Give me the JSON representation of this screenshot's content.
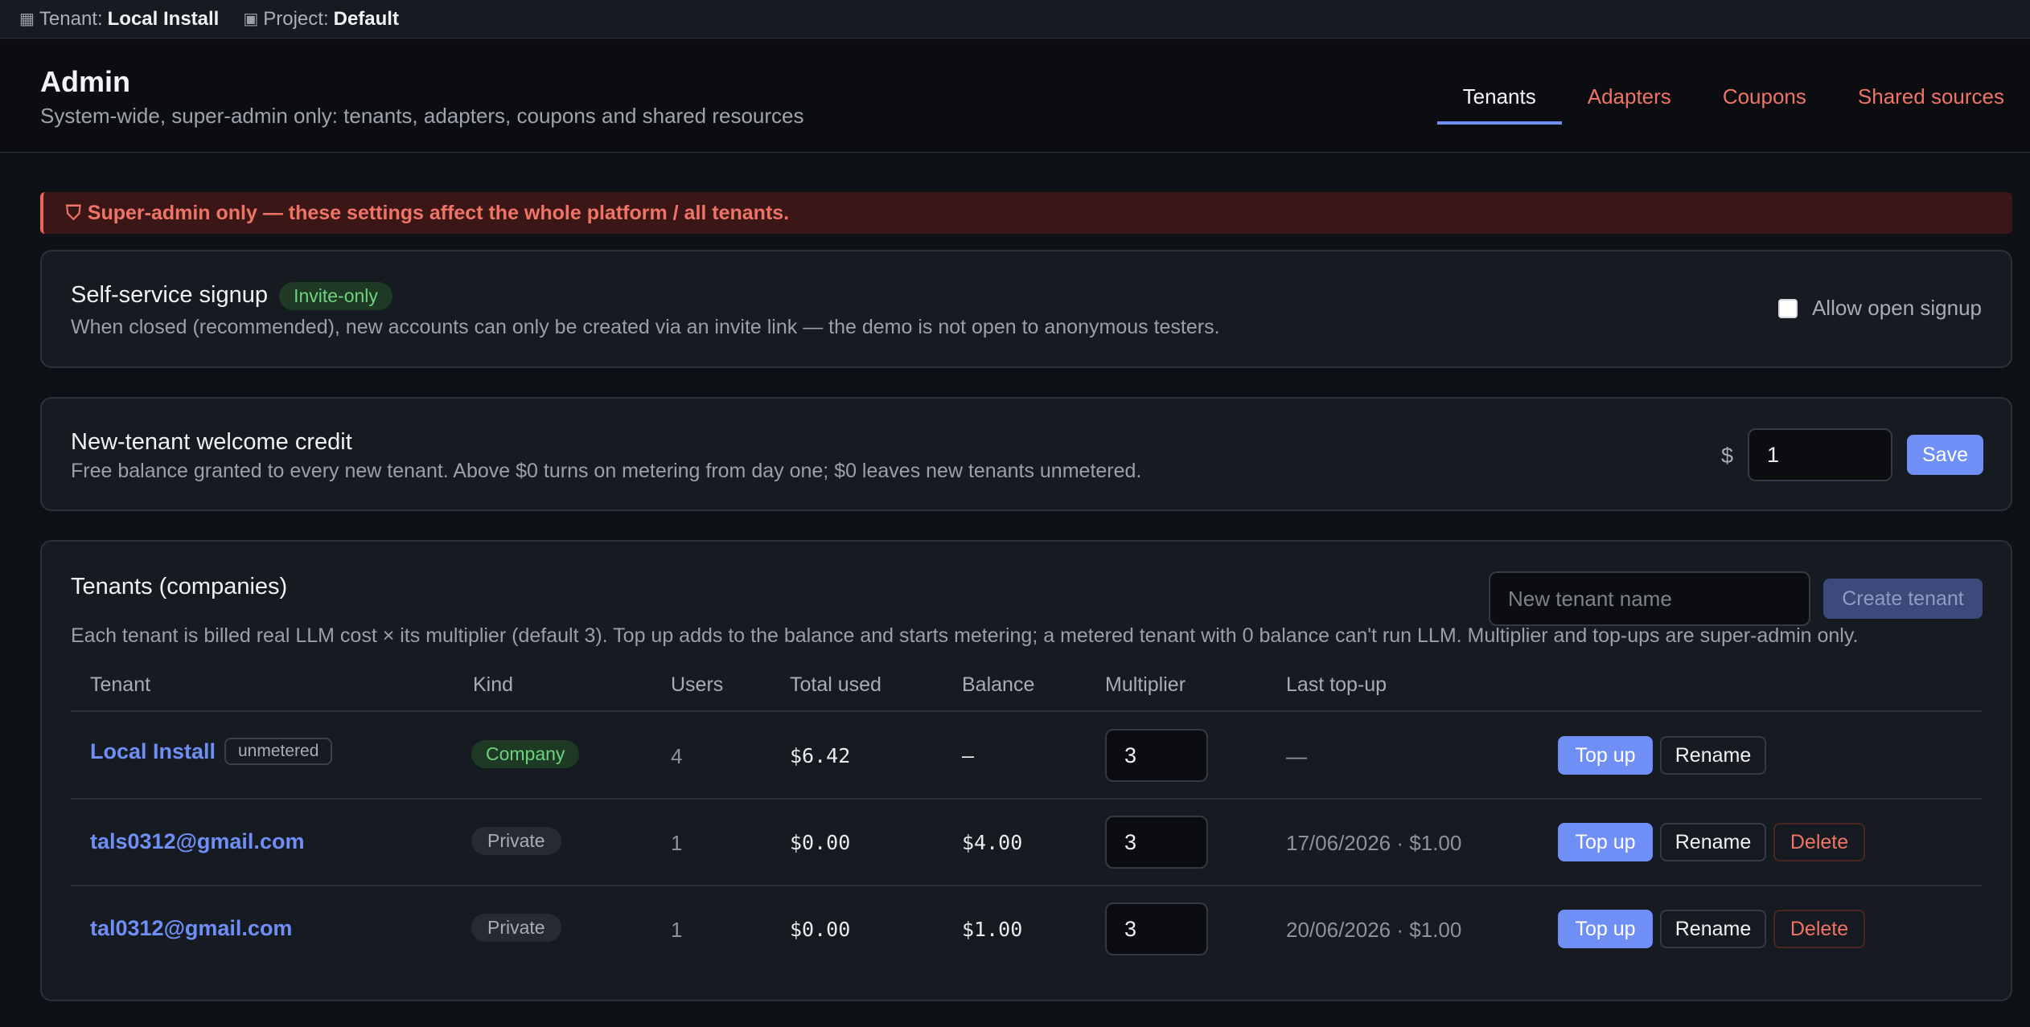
{
  "topbar": {
    "tenant_label": "Tenant:",
    "tenant_value": "Local Install",
    "project_label": "Project:",
    "project_value": "Default"
  },
  "header": {
    "title": "Admin",
    "subtitle": "System-wide, super-admin only: tenants, adapters, coupons and shared resources",
    "tabs": [
      {
        "label": "Tenants",
        "active": true
      },
      {
        "label": "Adapters",
        "active": false
      },
      {
        "label": "Coupons",
        "active": false
      },
      {
        "label": "Shared sources",
        "active": false
      }
    ]
  },
  "warning": {
    "icon": "shield-icon",
    "text": "Super-admin only — these settings affect the whole platform / all tenants."
  },
  "signup": {
    "title": "Self-service signup",
    "badge": "Invite-only",
    "desc": "When closed (recommended), new accounts can only be created via an invite link — the demo is not open to anonymous testers.",
    "checkbox_label": "Allow open signup",
    "checked": false
  },
  "credit": {
    "title": "New-tenant welcome credit",
    "desc": "Free balance granted to every new tenant. Above $0 turns on metering from day one; $0 leaves new tenants unmetered.",
    "currency": "$",
    "value": "1",
    "save_label": "Save"
  },
  "tenants": {
    "title": "Tenants (companies)",
    "new_placeholder": "New tenant name",
    "create_label": "Create tenant",
    "desc": "Each tenant is billed real LLM cost × its multiplier (default 3). Top up adds to the balance and starts metering; a metered tenant with 0 balance can't run LLM. Multiplier and top-ups are super-admin only.",
    "columns": [
      "Tenant",
      "Kind",
      "Users",
      "Total used",
      "Balance",
      "Multiplier",
      "Last top-up"
    ],
    "rows": [
      {
        "name": "Local Install",
        "tag": "unmetered",
        "kind": "Company",
        "users": "4",
        "total_used": "$6.42",
        "balance": "—",
        "multiplier": "3",
        "last_topup": "—",
        "topup": "Top up",
        "rename": "Rename",
        "delete": ""
      },
      {
        "name": "tals0312@gmail.com",
        "tag": "",
        "kind": "Private",
        "users": "1",
        "total_used": "$0.00",
        "balance": "$4.00",
        "multiplier": "3",
        "last_topup": "17/06/2026 · $1.00",
        "topup": "Top up",
        "rename": "Rename",
        "delete": "Delete"
      },
      {
        "name": "tal0312@gmail.com",
        "tag": "",
        "kind": "Private",
        "users": "1",
        "total_used": "$0.00",
        "balance": "$1.00",
        "multiplier": "3",
        "last_topup": "20/06/2026 · $1.00",
        "topup": "Top up",
        "rename": "Rename",
        "delete": "Delete"
      }
    ]
  },
  "colors": {
    "accent": "#6f8ff7",
    "danger": "#f07466",
    "success": "#6ed27f",
    "background": "#0e1116"
  }
}
